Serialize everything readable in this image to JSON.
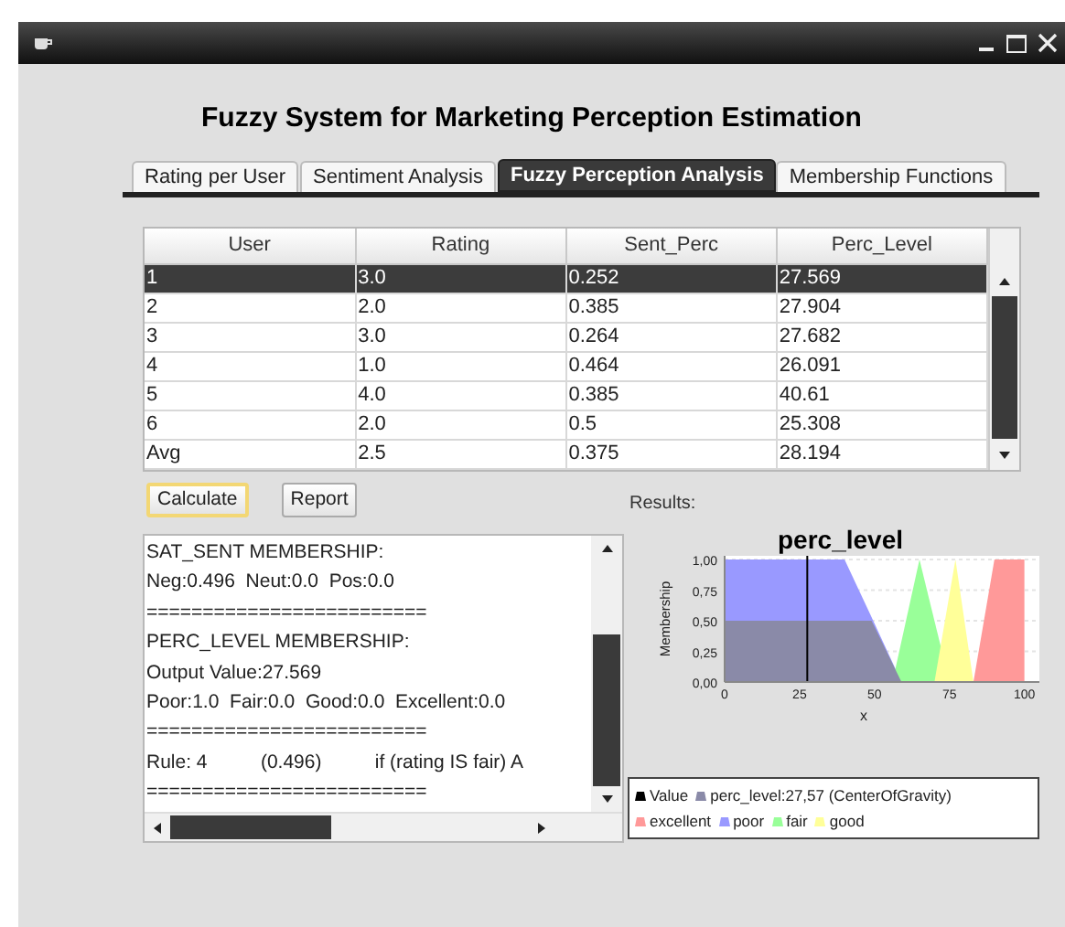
{
  "window": {
    "title": "Fuzzy System for Marketing Perception Estimation"
  },
  "tabs": [
    {
      "label": "Rating per User",
      "selected": false
    },
    {
      "label": "Sentiment Analysis",
      "selected": false
    },
    {
      "label": "Fuzzy Perception Analysis",
      "selected": true
    },
    {
      "label": "Membership Functions",
      "selected": false
    }
  ],
  "table": {
    "columns": [
      "User",
      "Rating",
      "Sent_Perc",
      "Perc_Level"
    ],
    "rows": [
      {
        "cells": [
          "1",
          "3.0",
          "0.252",
          "27.569"
        ],
        "selected": true
      },
      {
        "cells": [
          "2",
          "2.0",
          "0.385",
          "27.904"
        ],
        "selected": false
      },
      {
        "cells": [
          "3",
          "3.0",
          "0.264",
          "27.682"
        ],
        "selected": false
      },
      {
        "cells": [
          "4",
          "1.0",
          "0.464",
          "26.091"
        ],
        "selected": false
      },
      {
        "cells": [
          "5",
          "4.0",
          "0.385",
          "40.61"
        ],
        "selected": false
      },
      {
        "cells": [
          "6",
          "2.0",
          "0.5",
          "25.308"
        ],
        "selected": false
      },
      {
        "cells": [
          "Avg",
          "2.5",
          "0.375",
          "28.194"
        ],
        "selected": false
      }
    ]
  },
  "buttons": [
    {
      "label": "Calculate",
      "focused": true
    },
    {
      "label": "Report",
      "focused": false
    }
  ],
  "output_lines": [
    "SAT_SENT MEMBERSHIP:",
    "Neg:0.496  Neut:0.0  Pos:0.0",
    "=========================",
    "PERC_LEVEL MEMBERSHIP:",
    "Output Value:27.569",
    "Poor:1.0  Fair:0.0  Good:0.0  Excellent:0.0",
    "=========================",
    "Rule: 4          (0.496)          if (rating IS fair) A",
    "========================="
  ],
  "results": {
    "label": "Results:",
    "chart_data": {
      "type": "area",
      "title": "perc_level",
      "xlabel": "x",
      "ylabel": "Membership",
      "x": [
        0,
        40,
        49,
        56,
        59,
        65,
        70,
        75,
        77,
        83,
        90,
        100
      ],
      "series": [
        {
          "name": "excellent",
          "color": "#ff9999",
          "values": [
            null,
            null,
            null,
            null,
            null,
            null,
            null,
            null,
            null,
            0,
            1,
            1
          ]
        },
        {
          "name": "poor",
          "color": "#9999ff",
          "values": [
            1,
            1,
            0.53,
            null,
            0,
            null,
            null,
            null,
            null,
            null,
            null,
            null
          ]
        },
        {
          "name": "fair",
          "color": "#99ff99",
          "values": [
            null,
            null,
            null,
            0,
            null,
            1,
            null,
            0,
            null,
            null,
            null,
            null
          ]
        },
        {
          "name": "good",
          "color": "#ffff99",
          "values": [
            null,
            null,
            null,
            null,
            null,
            null,
            0,
            null,
            1,
            0,
            null,
            null
          ]
        },
        {
          "name": "perc_level:27,57 (CenterOfGravity)",
          "color": "#8a8aa8",
          "values": [
            0.5,
            0.5,
            0.5,
            null,
            0,
            null,
            null,
            null,
            null,
            null,
            null,
            null
          ]
        }
      ],
      "grid": true,
      "xlim": [
        0,
        105
      ],
      "ylim": [
        0,
        1.03
      ],
      "xticks": [
        0,
        25,
        50,
        75,
        100
      ],
      "yticks": [
        {
          "value": 0,
          "label": "0,00"
        },
        {
          "value": 0.25,
          "label": "0,25"
        },
        {
          "value": 0.5,
          "label": "0,50"
        },
        {
          "value": 0.75,
          "label": "0,75"
        },
        {
          "value": 1,
          "label": "1,00"
        }
      ],
      "ref_lines": [
        {
          "axis": "x",
          "value": 27.57,
          "label": "Value"
        }
      ]
    }
  }
}
